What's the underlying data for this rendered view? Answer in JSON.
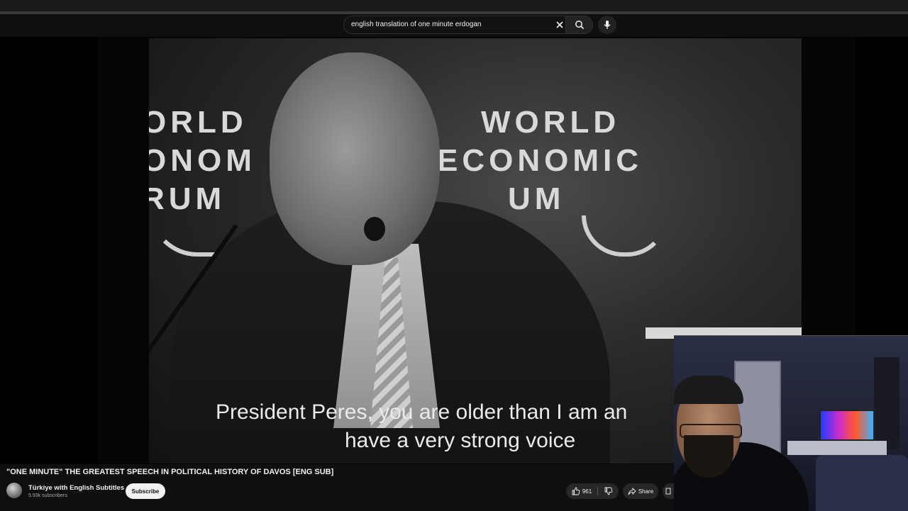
{
  "search": {
    "query": "english translation of one minute erdogan"
  },
  "video": {
    "backdrop_text_left": [
      "ORLD",
      "ONOM",
      "RUM"
    ],
    "backdrop_text_right": [
      "WORLD",
      "ECONOMIC",
      "UM"
    ],
    "subtitle_line1": "President Peres, you are older than I am an",
    "subtitle_line2": "have a very strong voice"
  },
  "title": "\"ONE MINUTE\" THE GREATEST SPEECH IN POLITICAL HISTORY OF DAVOS [ENG SUB]",
  "channel": {
    "name": "Türkiye with English Subtitles",
    "subscribers": "5.93k subscribers",
    "subscribe_label": "Subscribe"
  },
  "actions": {
    "like_count": "961",
    "share_label": "Share"
  },
  "icons": {
    "clear": "close-icon",
    "search": "search-icon",
    "mic": "microphone-icon",
    "like": "thumbs-up-icon",
    "dislike": "thumbs-down-icon",
    "share": "share-arrow-icon"
  }
}
